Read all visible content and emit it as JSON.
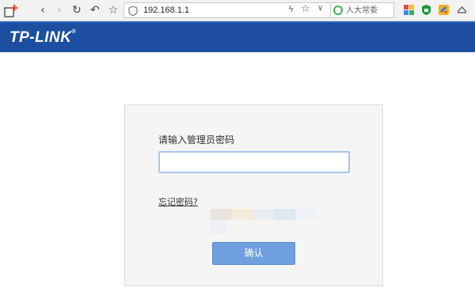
{
  "browser": {
    "url": "192.168.1.1",
    "search_placeholder": "人大常委",
    "icons": [
      "newtab-icon",
      "back-icon",
      "forward-icon",
      "reload-icon",
      "undo-icon",
      "star-icon",
      "shield-icon",
      "bolt-icon",
      "bookmark-star-icon",
      "chevron-down-icon",
      "search-icon",
      "apps-grid-icon",
      "adblock-shield-icon",
      "puzzle-icon",
      "cloud-icon"
    ],
    "glyphs": {
      "back": "‹",
      "forward": "›",
      "reload": "↻",
      "undo": "↶",
      "star": "☆",
      "bolt": "ϟ",
      "bookmark": "☆",
      "chevron": "∨"
    }
  },
  "header": {
    "logo": "TP-LINK",
    "logo_mark": "®",
    "colors": {
      "background": "#1c4fa0",
      "text": "#ffffff"
    }
  },
  "login": {
    "prompt": "请输入管理员密码",
    "password_value": "",
    "forgot_link": "忘记密码?",
    "confirm_button": "确认",
    "colors": {
      "button": "#6f9fde",
      "input_border": "#a7c7ee",
      "panel": "#f5f5f5"
    }
  }
}
